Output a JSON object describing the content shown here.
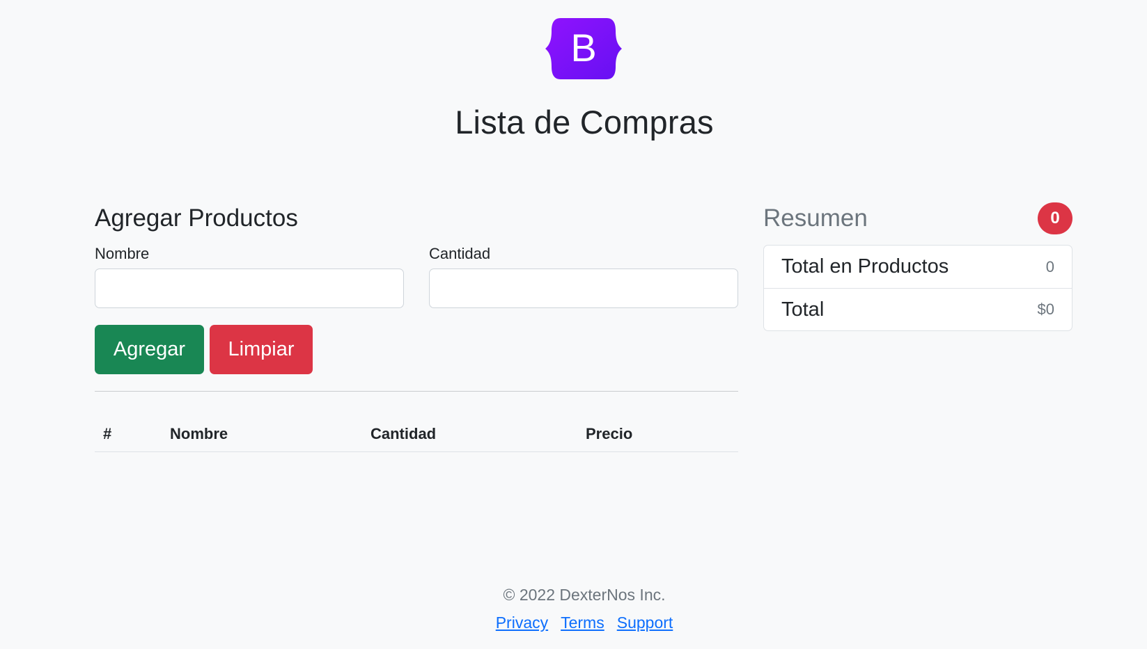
{
  "header": {
    "logo_letter": "B",
    "logo_color": "#7a0ff4",
    "title": "Lista de Compras"
  },
  "form": {
    "title": "Agregar Productos",
    "nombre_label": "Nombre",
    "nombre_value": "",
    "cantidad_label": "Cantidad",
    "cantidad_value": "",
    "add_label": "Agregar",
    "clear_label": "Limpiar"
  },
  "table": {
    "columns": [
      "#",
      "Nombre",
      "Cantidad",
      "Precio"
    ],
    "rows": []
  },
  "summary": {
    "title": "Resumen",
    "badge_count": "0",
    "items": [
      {
        "label": "Total en Productos",
        "value": "0"
      },
      {
        "label": "Total",
        "value": "$0"
      }
    ]
  },
  "footer": {
    "copyright": "© 2022 DexterNos Inc.",
    "links": [
      "Privacy",
      "Terms",
      "Support"
    ]
  },
  "colors": {
    "success": "#198754",
    "danger": "#dc3545",
    "link": "#0d6efd",
    "background": "#f8f9fa"
  }
}
